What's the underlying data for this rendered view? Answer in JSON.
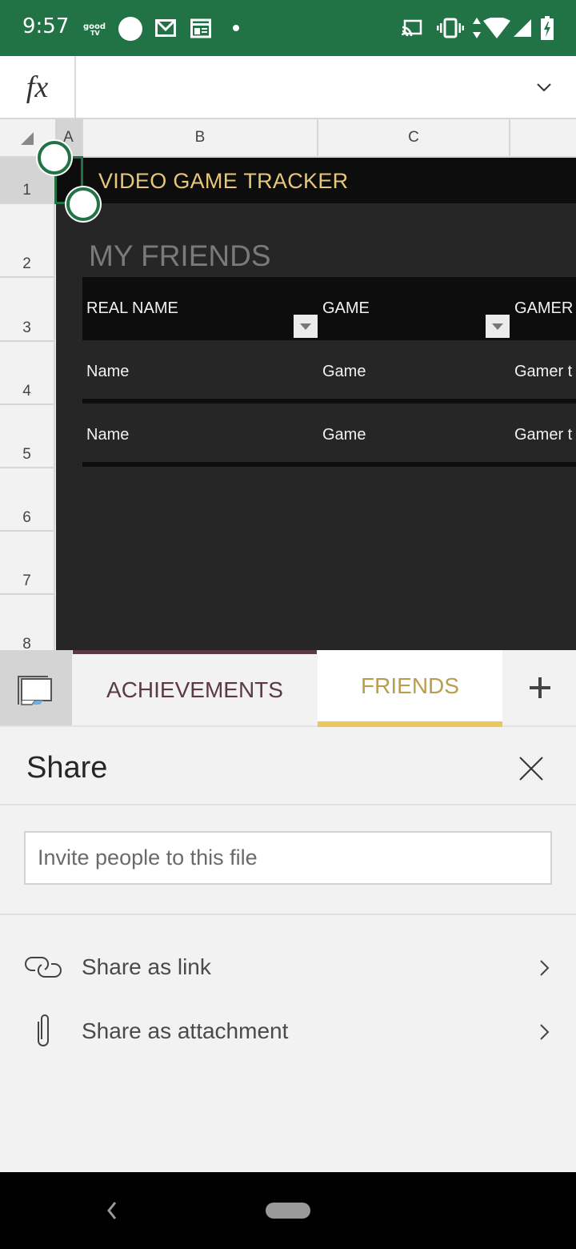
{
  "status_bar": {
    "time": "9:57",
    "left_icons": [
      "good-tv-icon",
      "circle-notification-icon",
      "gmail-icon",
      "calendar-icon",
      "dot-icon"
    ],
    "right_icons": [
      "cast-icon",
      "vibrate-icon",
      "data-arrows-icon",
      "wifi-icon",
      "signal-icon",
      "battery-charging-icon"
    ],
    "background": "#217346"
  },
  "formula_bar": {
    "fx_label": "fx",
    "value": "",
    "expand_icon": "chevron-down-icon"
  },
  "grid": {
    "columns": [
      "A",
      "B",
      "C"
    ],
    "rows": [
      "1",
      "2",
      "3",
      "4",
      "5",
      "6",
      "7",
      "8"
    ],
    "selected_cell": "A1"
  },
  "sheet": {
    "title": "VIDEO GAME TRACKER",
    "section_heading": "MY FRIENDS",
    "table": {
      "headers": [
        "REAL NAME",
        "GAME",
        "GAMER"
      ],
      "rows": [
        [
          "Name",
          "Game",
          "Gamer t"
        ],
        [
          "Name",
          "Game",
          "Gamer t"
        ]
      ]
    },
    "colors": {
      "title": "#e8c878",
      "band": "#0d0d0d",
      "body": "#262626"
    }
  },
  "tabs": {
    "items": [
      {
        "label": "ACHIEVEMENTS",
        "active": false,
        "color": "#5b3a42"
      },
      {
        "label": "FRIENDS",
        "active": true,
        "color": "#b89e4e"
      }
    ],
    "add_label": "+",
    "accent": "#ecc85a"
  },
  "share": {
    "title": "Share",
    "invite_placeholder": "Invite people to this file",
    "invite_value": "",
    "options": [
      {
        "label": "Share as link",
        "icon": "link-icon"
      },
      {
        "label": "Share as attachment",
        "icon": "paperclip-icon"
      }
    ]
  },
  "nav_bar": {
    "back_icon": "back-icon",
    "home_icon": "home-pill-icon"
  }
}
